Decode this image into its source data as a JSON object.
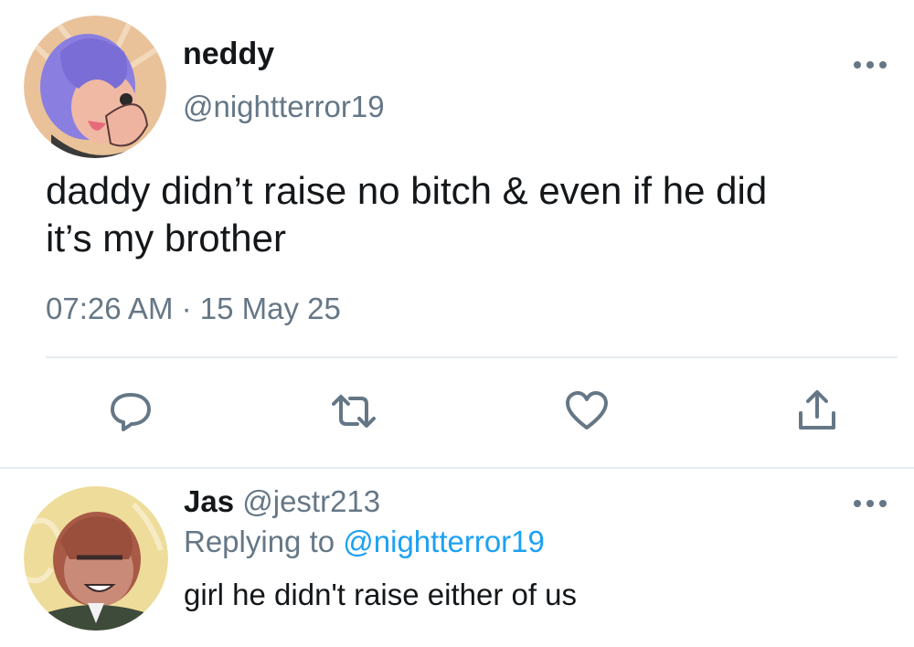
{
  "tweet": {
    "display_name": "neddy",
    "handle": "@nightterror19",
    "text_line1": "daddy didn’t raise no bitch & even if he did",
    "text_line2": "it’s my brother",
    "timestamp": "07:26 AM · 15 May 25",
    "actions": [
      "reply-icon",
      "retweet-icon",
      "like-icon",
      "share-icon"
    ],
    "more_icon": "more-icon"
  },
  "reply": {
    "display_name": "Jas",
    "handle": "@jestr213",
    "replying_prefix": "Replying to ",
    "replying_handle": "@nightterror19",
    "text": "girl he didn't raise either of us",
    "more_icon": "more-icon"
  },
  "colors": {
    "text": "#14171a",
    "secondary": "#657786",
    "link": "#1da1f2",
    "divider": "#e6ecf0"
  }
}
